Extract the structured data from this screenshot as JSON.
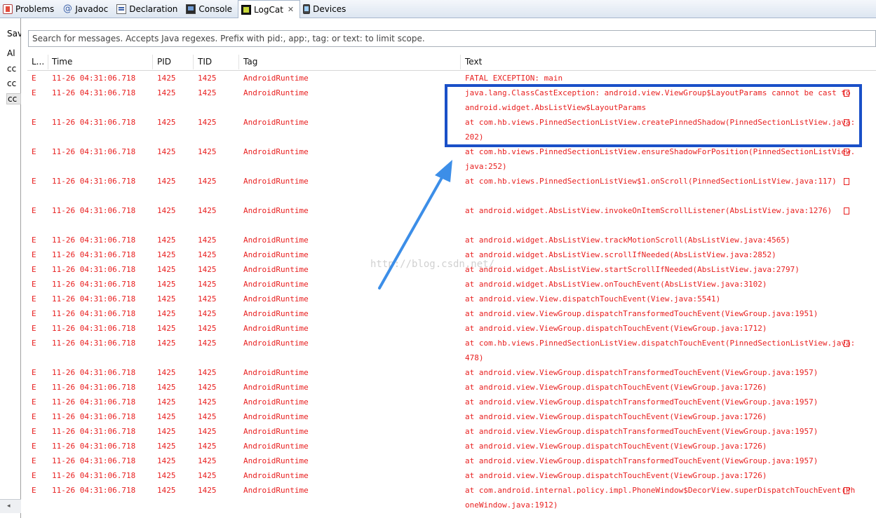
{
  "tabs": [
    {
      "label": "Problems",
      "icon": "problems-icon"
    },
    {
      "label": "Javadoc",
      "icon": "javadoc-icon"
    },
    {
      "label": "Declaration",
      "icon": "declaration-icon"
    },
    {
      "label": "Console",
      "icon": "console-icon"
    },
    {
      "label": "LogCat",
      "icon": "logcat-icon",
      "active": true,
      "close": "✕"
    },
    {
      "label": "Devices",
      "icon": "devices-icon"
    }
  ],
  "left_panel": {
    "header": "Sav",
    "items": [
      "Al",
      "cc",
      "cc",
      "cc"
    ],
    "scroll_arrow": "◂"
  },
  "search": {
    "placeholder": "Search for messages. Accepts Java regexes. Prefix with pid:, app:, tag: or text: to limit scope."
  },
  "columns": {
    "level": "L...",
    "time": "Time",
    "pid": "PID",
    "tid": "TID",
    "tag": "Tag",
    "text": "Text"
  },
  "log_color": "#e81f1f",
  "annotation": {
    "box_color": "#1a50c8",
    "arrow_color": "#3c8ee8",
    "watermark": "http://blog.csdn.net/"
  },
  "rows": [
    {
      "level": "E",
      "time": "11-26 04:31:06.718",
      "pid": "1425",
      "tid": "1425",
      "tag": "AndroidRuntime",
      "text": "FATAL EXCEPTION: main",
      "wrapped": false
    },
    {
      "level": "E",
      "time": "11-26 04:31:06.718",
      "pid": "1425",
      "tid": "1425",
      "tag": "AndroidRuntime",
      "text": "java.lang.ClassCastException: android.view.ViewGroup$LayoutParams cannot be cast to android.widget.AbsListView$LayoutParams",
      "wrapped": true
    },
    {
      "level": "E",
      "time": "11-26 04:31:06.718",
      "pid": "1425",
      "tid": "1425",
      "tag": "AndroidRuntime",
      "text": "at com.hb.views.PinnedSectionListView.createPinnedShadow(PinnedSectionListView.java:202)",
      "wrapped": true
    },
    {
      "level": "E",
      "time": "11-26 04:31:06.718",
      "pid": "1425",
      "tid": "1425",
      "tag": "AndroidRuntime",
      "text": "at com.hb.views.PinnedSectionListView.ensureShadowForPosition(PinnedSectionListView.java:252)",
      "wrapped": true
    },
    {
      "level": "E",
      "time": "11-26 04:31:06.718",
      "pid": "1425",
      "tid": "1425",
      "tag": "AndroidRuntime",
      "text": "at com.hb.views.PinnedSectionListView$1.onScroll(PinnedSectionListView.java:117)",
      "wrapped": true
    },
    {
      "level": "E",
      "time": "11-26 04:31:06.718",
      "pid": "1425",
      "tid": "1425",
      "tag": "AndroidRuntime",
      "text": "at android.widget.AbsListView.invokeOnItemScrollListener(AbsListView.java:1276)",
      "wrapped": true
    },
    {
      "level": "E",
      "time": "11-26 04:31:06.718",
      "pid": "1425",
      "tid": "1425",
      "tag": "AndroidRuntime",
      "text": "at android.widget.AbsListView.trackMotionScroll(AbsListView.java:4565)",
      "wrapped": false
    },
    {
      "level": "E",
      "time": "11-26 04:31:06.718",
      "pid": "1425",
      "tid": "1425",
      "tag": "AndroidRuntime",
      "text": "at android.widget.AbsListView.scrollIfNeeded(AbsListView.java:2852)",
      "wrapped": false
    },
    {
      "level": "E",
      "time": "11-26 04:31:06.718",
      "pid": "1425",
      "tid": "1425",
      "tag": "AndroidRuntime",
      "text": "at android.widget.AbsListView.startScrollIfNeeded(AbsListView.java:2797)",
      "wrapped": false
    },
    {
      "level": "E",
      "time": "11-26 04:31:06.718",
      "pid": "1425",
      "tid": "1425",
      "tag": "AndroidRuntime",
      "text": "at android.widget.AbsListView.onTouchEvent(AbsListView.java:3102)",
      "wrapped": false
    },
    {
      "level": "E",
      "time": "11-26 04:31:06.718",
      "pid": "1425",
      "tid": "1425",
      "tag": "AndroidRuntime",
      "text": "at android.view.View.dispatchTouchEvent(View.java:5541)",
      "wrapped": false
    },
    {
      "level": "E",
      "time": "11-26 04:31:06.718",
      "pid": "1425",
      "tid": "1425",
      "tag": "AndroidRuntime",
      "text": "at android.view.ViewGroup.dispatchTransformedTouchEvent(ViewGroup.java:1951)",
      "wrapped": false
    },
    {
      "level": "E",
      "time": "11-26 04:31:06.718",
      "pid": "1425",
      "tid": "1425",
      "tag": "AndroidRuntime",
      "text": "at android.view.ViewGroup.dispatchTouchEvent(ViewGroup.java:1712)",
      "wrapped": false
    },
    {
      "level": "E",
      "time": "11-26 04:31:06.718",
      "pid": "1425",
      "tid": "1425",
      "tag": "AndroidRuntime",
      "text": "at com.hb.views.PinnedSectionListView.dispatchTouchEvent(PinnedSectionListView.java:478)",
      "wrapped": true
    },
    {
      "level": "E",
      "time": "11-26 04:31:06.718",
      "pid": "1425",
      "tid": "1425",
      "tag": "AndroidRuntime",
      "text": "at android.view.ViewGroup.dispatchTransformedTouchEvent(ViewGroup.java:1957)",
      "wrapped": false
    },
    {
      "level": "E",
      "time": "11-26 04:31:06.718",
      "pid": "1425",
      "tid": "1425",
      "tag": "AndroidRuntime",
      "text": "at android.view.ViewGroup.dispatchTouchEvent(ViewGroup.java:1726)",
      "wrapped": false
    },
    {
      "level": "E",
      "time": "11-26 04:31:06.718",
      "pid": "1425",
      "tid": "1425",
      "tag": "AndroidRuntime",
      "text": "at android.view.ViewGroup.dispatchTransformedTouchEvent(ViewGroup.java:1957)",
      "wrapped": false
    },
    {
      "level": "E",
      "time": "11-26 04:31:06.718",
      "pid": "1425",
      "tid": "1425",
      "tag": "AndroidRuntime",
      "text": "at android.view.ViewGroup.dispatchTouchEvent(ViewGroup.java:1726)",
      "wrapped": false
    },
    {
      "level": "E",
      "time": "11-26 04:31:06.718",
      "pid": "1425",
      "tid": "1425",
      "tag": "AndroidRuntime",
      "text": "at android.view.ViewGroup.dispatchTransformedTouchEvent(ViewGroup.java:1957)",
      "wrapped": false
    },
    {
      "level": "E",
      "time": "11-26 04:31:06.718",
      "pid": "1425",
      "tid": "1425",
      "tag": "AndroidRuntime",
      "text": "at android.view.ViewGroup.dispatchTouchEvent(ViewGroup.java:1726)",
      "wrapped": false
    },
    {
      "level": "E",
      "time": "11-26 04:31:06.718",
      "pid": "1425",
      "tid": "1425",
      "tag": "AndroidRuntime",
      "text": "at android.view.ViewGroup.dispatchTransformedTouchEvent(ViewGroup.java:1957)",
      "wrapped": false
    },
    {
      "level": "E",
      "time": "11-26 04:31:06.718",
      "pid": "1425",
      "tid": "1425",
      "tag": "AndroidRuntime",
      "text": "at android.view.ViewGroup.dispatchTouchEvent(ViewGroup.java:1726)",
      "wrapped": false
    },
    {
      "level": "E",
      "time": "11-26 04:31:06.718",
      "pid": "1425",
      "tid": "1425",
      "tag": "AndroidRuntime",
      "text": "at com.android.internal.policy.impl.PhoneWindow$DecorView.superDispatchTouchEvent(PhoneWindow.java:1912)",
      "wrapped": true
    }
  ]
}
